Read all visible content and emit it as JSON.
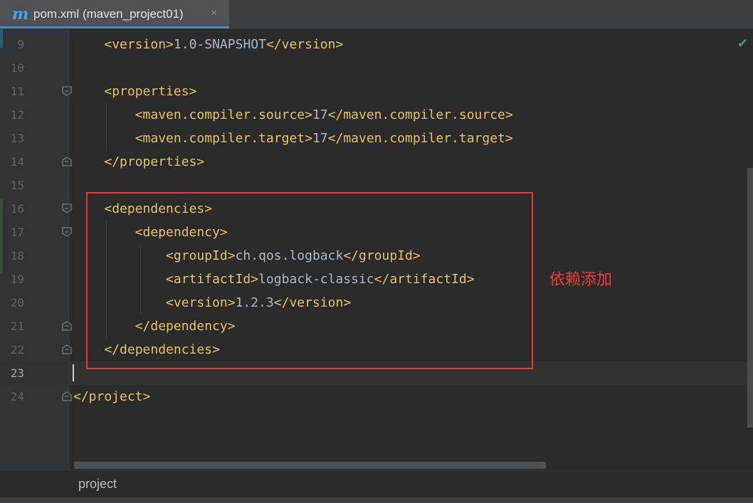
{
  "tab": {
    "icon": "m",
    "title": "pom.xml (maven_project01)",
    "close": "×"
  },
  "editor": {
    "status_icon": "✔",
    "annotation": "依赖添加",
    "current_line": "23",
    "lines": [
      {
        "num": "9",
        "indent": "    ",
        "tokens": [
          [
            "tag",
            "<version>"
          ],
          [
            "txt",
            "1.0-SNAPSHOT"
          ],
          [
            "tag",
            "</version>"
          ]
        ]
      },
      {
        "num": "10",
        "indent": "",
        "tokens": []
      },
      {
        "num": "11",
        "indent": "    ",
        "tokens": [
          [
            "tag",
            "<properties>"
          ]
        ]
      },
      {
        "num": "12",
        "indent": "        ",
        "tokens": [
          [
            "tag",
            "<maven.compiler.source>"
          ],
          [
            "txt",
            "17"
          ],
          [
            "tag",
            "</maven.compiler.source>"
          ]
        ]
      },
      {
        "num": "13",
        "indent": "        ",
        "tokens": [
          [
            "tag",
            "<maven.compiler.target>"
          ],
          [
            "txt",
            "17"
          ],
          [
            "tag",
            "</maven.compiler.target>"
          ]
        ]
      },
      {
        "num": "14",
        "indent": "    ",
        "tokens": [
          [
            "tag",
            "</properties>"
          ]
        ]
      },
      {
        "num": "15",
        "indent": "",
        "tokens": []
      },
      {
        "num": "16",
        "indent": "    ",
        "tokens": [
          [
            "tag",
            "<dependencies>"
          ]
        ]
      },
      {
        "num": "17",
        "indent": "        ",
        "tokens": [
          [
            "tag",
            "<dependency>"
          ]
        ]
      },
      {
        "num": "18",
        "indent": "            ",
        "tokens": [
          [
            "tag",
            "<groupId>"
          ],
          [
            "txt",
            "ch.qos.logback"
          ],
          [
            "tag",
            "</groupId>"
          ]
        ]
      },
      {
        "num": "19",
        "indent": "            ",
        "tokens": [
          [
            "tag",
            "<artifactId>"
          ],
          [
            "txt",
            "logback-classic"
          ],
          [
            "tag",
            "</artifactId>"
          ]
        ]
      },
      {
        "num": "20",
        "indent": "            ",
        "tokens": [
          [
            "tag",
            "<version>"
          ],
          [
            "txt",
            "1.2.3"
          ],
          [
            "tag",
            "</version>"
          ]
        ]
      },
      {
        "num": "21",
        "indent": "        ",
        "tokens": [
          [
            "tag",
            "</dependency>"
          ]
        ]
      },
      {
        "num": "22",
        "indent": "    ",
        "tokens": [
          [
            "tag",
            "</dependencies>"
          ]
        ]
      },
      {
        "num": "23",
        "indent": "",
        "tokens": []
      },
      {
        "num": "24",
        "indent": "",
        "tokens": [
          [
            "tag",
            "</project>"
          ]
        ]
      }
    ]
  },
  "breadcrumb": {
    "item": "project"
  },
  "colors": {
    "tag": "#e8bf6a",
    "text": "#a9b7c6",
    "annotation_red": "#e23a3a",
    "tab_accent": "#4a88c7"
  }
}
